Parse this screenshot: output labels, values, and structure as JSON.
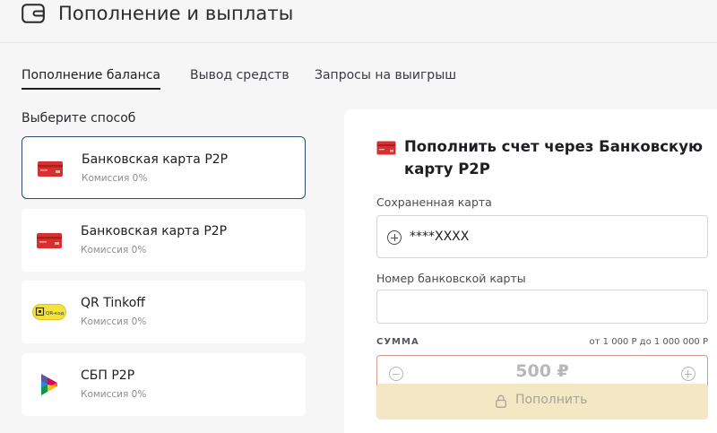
{
  "header": {
    "title": "Пополнение и выплаты",
    "icon": "wallet-icon"
  },
  "tabs": [
    {
      "label": "Пополнение баланса",
      "active": true
    },
    {
      "label": "Вывод средств",
      "active": false
    },
    {
      "label": "Запросы на выигрыш",
      "active": false
    }
  ],
  "methods": {
    "label": "Выберите способ",
    "items": [
      {
        "name": "Банковская карта P2P",
        "fee": "Комиссия 0%",
        "icon": "bank-card-icon",
        "selected": true
      },
      {
        "name": "Банковская карта P2P",
        "fee": "Комиссия 0%",
        "icon": "bank-card-icon",
        "selected": false
      },
      {
        "name": "QR Tinkoff",
        "fee": "Комиссия 0%",
        "icon": "qr-code-icon",
        "icon_text": "QR-код",
        "selected": false
      },
      {
        "name": "СБП P2P",
        "fee": "Комиссия 0%",
        "icon": "sbp-icon",
        "selected": false
      }
    ]
  },
  "panel": {
    "title": "Пополнить счет через Банковскую карту P2P",
    "saved_card_label": "Сохраненная карта",
    "saved_card_value": "****XXXX",
    "card_number_label": "Номер банковской карты",
    "card_number_value": "",
    "sum_label": "СУММА",
    "sum_range": "от 1 000 Р до 1 000 000 Р",
    "amount": "500 ₽",
    "submit_label": "Пополнить"
  },
  "colors": {
    "accent": "#1e1e22",
    "card_red": "#d92f2f",
    "selected_border": "#2f4a73",
    "button_bg": "#f3e7c4",
    "qr_yellow": "#f5e23a"
  }
}
